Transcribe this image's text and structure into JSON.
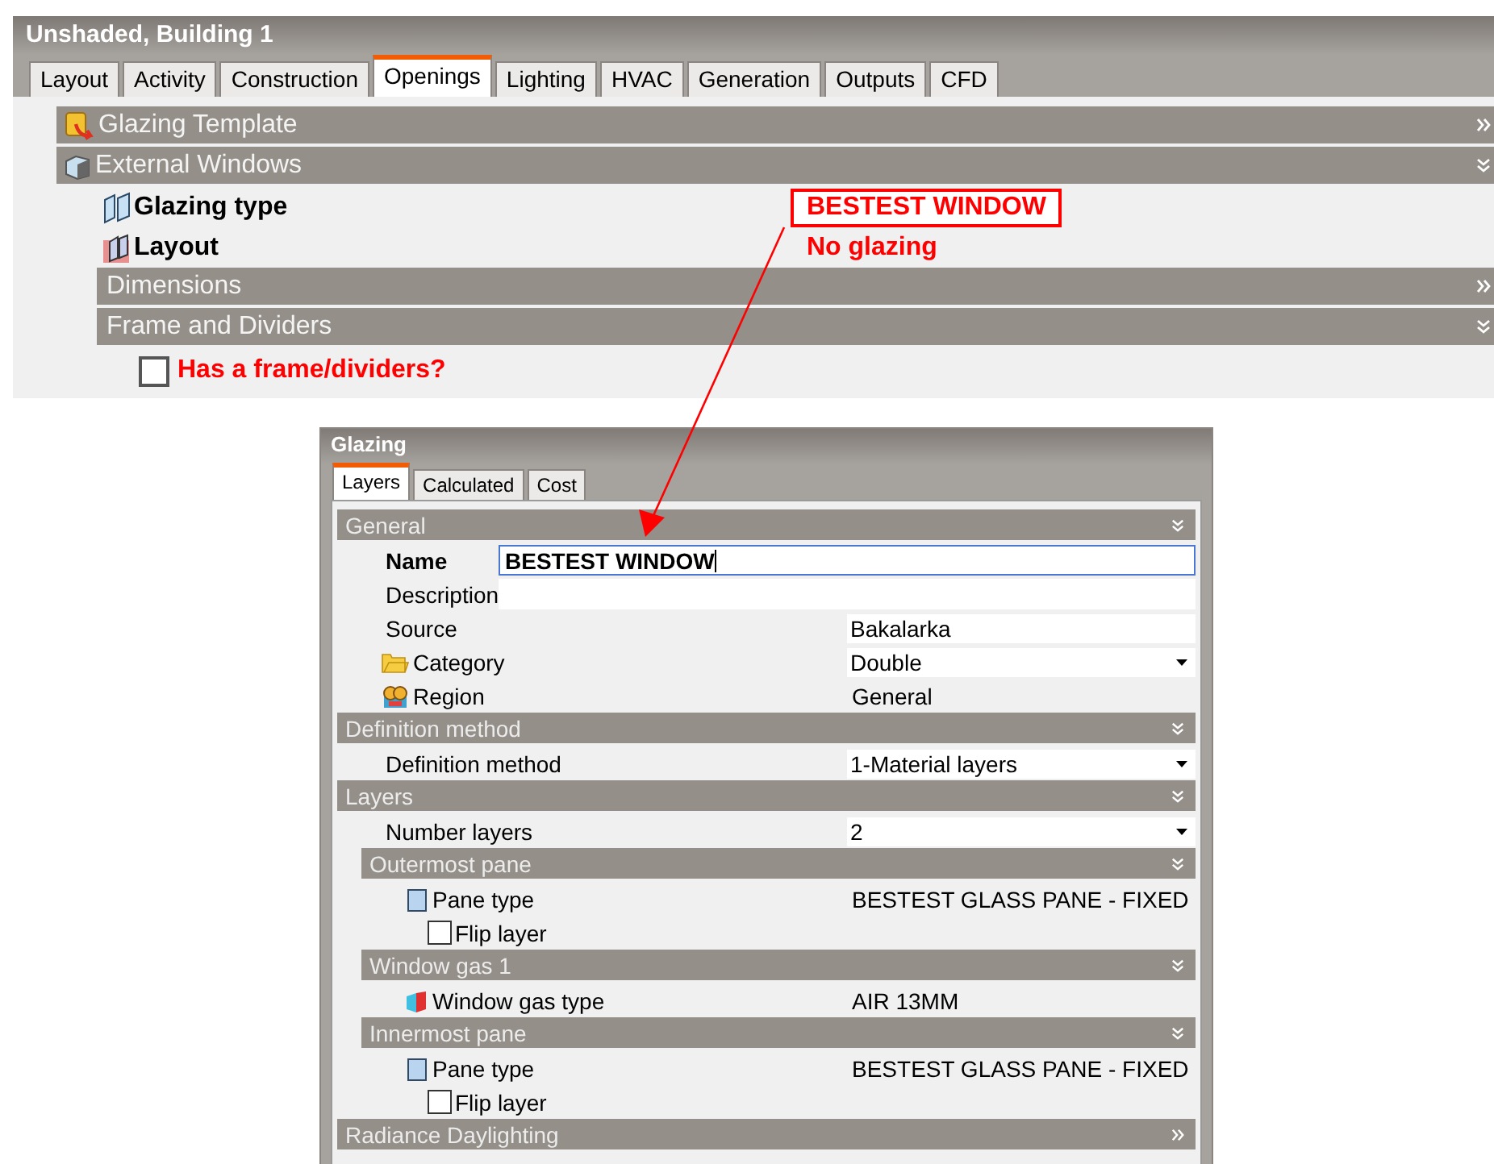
{
  "window": {
    "title": "Unshaded, Building 1"
  },
  "tabs": [
    {
      "label": "Layout",
      "selected": false
    },
    {
      "label": "Activity",
      "selected": false
    },
    {
      "label": "Construction",
      "selected": false
    },
    {
      "label": "Openings",
      "selected": true
    },
    {
      "label": "Lighting",
      "selected": false
    },
    {
      "label": "HVAC",
      "selected": false
    },
    {
      "label": "Generation",
      "selected": false
    },
    {
      "label": "Outputs",
      "selected": false
    },
    {
      "label": "CFD",
      "selected": false
    }
  ],
  "openings": [
    {
      "kind": "section",
      "title": "Glazing Template",
      "expanded": false
    },
    {
      "kind": "section",
      "title": "External Windows",
      "expanded": true,
      "children": [
        {
          "kind": "field",
          "label": "Glazing type",
          "value": "BESTEST WINDOW",
          "annotated": true
        },
        {
          "kind": "field",
          "label": "Layout",
          "value": "No glazing",
          "annotated": false
        },
        {
          "kind": "section",
          "title": "Dimensions",
          "expanded": false
        },
        {
          "kind": "section",
          "title": "Frame and Dividers",
          "expanded": true,
          "children": [
            {
              "kind": "checkbox",
              "label": "Has a frame/dividers?",
              "checked": false
            }
          ]
        }
      ]
    }
  ],
  "glazing": {
    "title": "Glazing",
    "tabs": [
      {
        "label": "Layers",
        "selected": true
      },
      {
        "label": "Calculated",
        "selected": false
      },
      {
        "label": "Cost",
        "selected": false
      }
    ],
    "sections": [
      {
        "kind": "section",
        "title": "General",
        "expanded": true,
        "children": [
          {
            "kind": "input",
            "label": "Name",
            "value": "BESTEST WINDOW",
            "required": true,
            "focused": true
          },
          {
            "kind": "input",
            "label": "Description",
            "required": false,
            "focused": false
          },
          {
            "kind": "text",
            "label": "Source",
            "value": "Bakalarka"
          },
          {
            "kind": "select",
            "label": "Category",
            "value": "Double"
          },
          {
            "kind": "static",
            "label": "Region",
            "value": "General"
          }
        ]
      },
      {
        "kind": "section",
        "title": "Definition method",
        "expanded": true,
        "children": [
          {
            "kind": "select",
            "label": "Definition method",
            "value": "1-Material layers"
          }
        ]
      },
      {
        "kind": "section",
        "title": "Layers",
        "expanded": true,
        "children": [
          {
            "kind": "select",
            "label": "Number layers",
            "value": "2"
          },
          {
            "kind": "section",
            "title": "Outermost pane",
            "expanded": true,
            "children": [
              {
                "kind": "static",
                "label": "Pane type",
                "value": "BESTEST GLASS PANE - FIXED"
              },
              {
                "kind": "checkbox",
                "label": "Flip layer",
                "checked": false
              }
            ]
          },
          {
            "kind": "section",
            "title": "Window gas 1",
            "expanded": true,
            "children": [
              {
                "kind": "static",
                "label": "Window gas type",
                "value": "AIR 13MM"
              }
            ]
          },
          {
            "kind": "section",
            "title": "Innermost pane",
            "expanded": true,
            "children": [
              {
                "kind": "static",
                "label": "Pane type",
                "value": "BESTEST GLASS PANE - FIXED"
              },
              {
                "kind": "checkbox",
                "label": "Flip layer",
                "checked": false
              }
            ]
          }
        ]
      },
      {
        "kind": "section",
        "title": "Radiance Daylighting",
        "expanded": false
      }
    ]
  }
}
